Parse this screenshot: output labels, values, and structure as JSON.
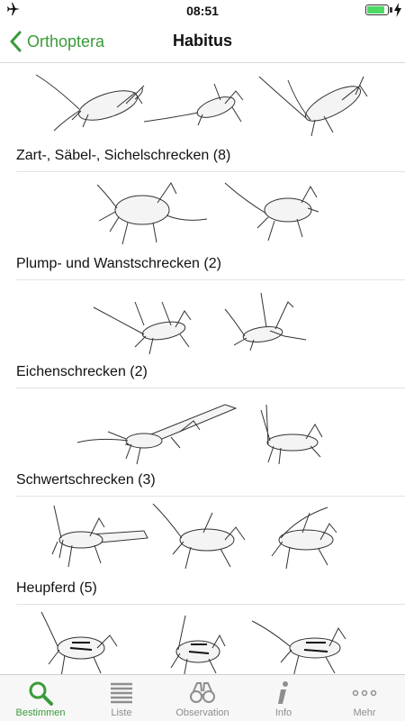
{
  "status": {
    "time": "08:51",
    "airplane_icon": "airplane-icon",
    "battery_icon": "battery-icon",
    "battery_level": 0.85,
    "accent": "#4cd964"
  },
  "nav": {
    "back_label": "Orthoptera",
    "title": "Habitus",
    "accent": "#3a9a3a"
  },
  "groups": [
    {
      "label": "Zart-, Säbel-, Sichelschrecken (8)"
    },
    {
      "label": "Plump- und Wanstschrecken (2)"
    },
    {
      "label": "Eichenschrecken (2)"
    },
    {
      "label": "Schwertschrecken (3)"
    },
    {
      "label": "Heupferd (5)"
    },
    {
      "label": ""
    }
  ],
  "tabs": [
    {
      "label": "Bestimmen",
      "icon": "search-icon",
      "active": true
    },
    {
      "label": "Liste",
      "icon": "list-icon",
      "active": false
    },
    {
      "label": "Observation",
      "icon": "binoculars-icon",
      "active": false
    },
    {
      "label": "Info",
      "icon": "info-icon",
      "active": false
    },
    {
      "label": "Mehr",
      "icon": "more-icon",
      "active": false
    }
  ]
}
